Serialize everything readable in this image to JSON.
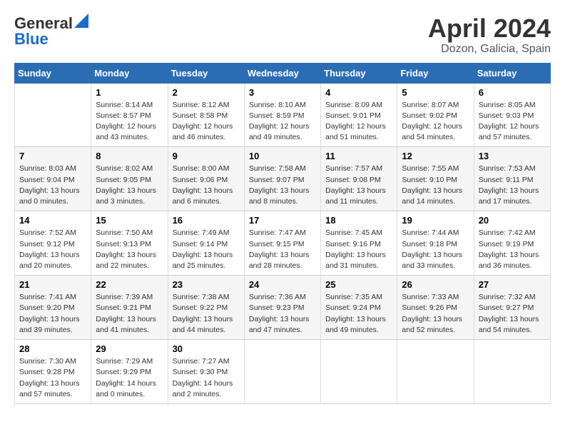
{
  "header": {
    "logo_general": "General",
    "logo_blue": "Blue",
    "month_title": "April 2024",
    "location": "Dozon, Galicia, Spain"
  },
  "columns": [
    "Sunday",
    "Monday",
    "Tuesday",
    "Wednesday",
    "Thursday",
    "Friday",
    "Saturday"
  ],
  "weeks": [
    [
      {
        "day": "",
        "sunrise": "",
        "sunset": "",
        "daylight": ""
      },
      {
        "day": "1",
        "sunrise": "Sunrise: 8:14 AM",
        "sunset": "Sunset: 8:57 PM",
        "daylight": "Daylight: 12 hours and 43 minutes."
      },
      {
        "day": "2",
        "sunrise": "Sunrise: 8:12 AM",
        "sunset": "Sunset: 8:58 PM",
        "daylight": "Daylight: 12 hours and 46 minutes."
      },
      {
        "day": "3",
        "sunrise": "Sunrise: 8:10 AM",
        "sunset": "Sunset: 8:59 PM",
        "daylight": "Daylight: 12 hours and 49 minutes."
      },
      {
        "day": "4",
        "sunrise": "Sunrise: 8:09 AM",
        "sunset": "Sunset: 9:01 PM",
        "daylight": "Daylight: 12 hours and 51 minutes."
      },
      {
        "day": "5",
        "sunrise": "Sunrise: 8:07 AM",
        "sunset": "Sunset: 9:02 PM",
        "daylight": "Daylight: 12 hours and 54 minutes."
      },
      {
        "day": "6",
        "sunrise": "Sunrise: 8:05 AM",
        "sunset": "Sunset: 9:03 PM",
        "daylight": "Daylight: 12 hours and 57 minutes."
      }
    ],
    [
      {
        "day": "7",
        "sunrise": "Sunrise: 8:03 AM",
        "sunset": "Sunset: 9:04 PM",
        "daylight": "Daylight: 13 hours and 0 minutes."
      },
      {
        "day": "8",
        "sunrise": "Sunrise: 8:02 AM",
        "sunset": "Sunset: 9:05 PM",
        "daylight": "Daylight: 13 hours and 3 minutes."
      },
      {
        "day": "9",
        "sunrise": "Sunrise: 8:00 AM",
        "sunset": "Sunset: 9:06 PM",
        "daylight": "Daylight: 13 hours and 6 minutes."
      },
      {
        "day": "10",
        "sunrise": "Sunrise: 7:58 AM",
        "sunset": "Sunset: 9:07 PM",
        "daylight": "Daylight: 13 hours and 8 minutes."
      },
      {
        "day": "11",
        "sunrise": "Sunrise: 7:57 AM",
        "sunset": "Sunset: 9:08 PM",
        "daylight": "Daylight: 13 hours and 11 minutes."
      },
      {
        "day": "12",
        "sunrise": "Sunrise: 7:55 AM",
        "sunset": "Sunset: 9:10 PM",
        "daylight": "Daylight: 13 hours and 14 minutes."
      },
      {
        "day": "13",
        "sunrise": "Sunrise: 7:53 AM",
        "sunset": "Sunset: 9:11 PM",
        "daylight": "Daylight: 13 hours and 17 minutes."
      }
    ],
    [
      {
        "day": "14",
        "sunrise": "Sunrise: 7:52 AM",
        "sunset": "Sunset: 9:12 PM",
        "daylight": "Daylight: 13 hours and 20 minutes."
      },
      {
        "day": "15",
        "sunrise": "Sunrise: 7:50 AM",
        "sunset": "Sunset: 9:13 PM",
        "daylight": "Daylight: 13 hours and 22 minutes."
      },
      {
        "day": "16",
        "sunrise": "Sunrise: 7:49 AM",
        "sunset": "Sunset: 9:14 PM",
        "daylight": "Daylight: 13 hours and 25 minutes."
      },
      {
        "day": "17",
        "sunrise": "Sunrise: 7:47 AM",
        "sunset": "Sunset: 9:15 PM",
        "daylight": "Daylight: 13 hours and 28 minutes."
      },
      {
        "day": "18",
        "sunrise": "Sunrise: 7:45 AM",
        "sunset": "Sunset: 9:16 PM",
        "daylight": "Daylight: 13 hours and 31 minutes."
      },
      {
        "day": "19",
        "sunrise": "Sunrise: 7:44 AM",
        "sunset": "Sunset: 9:18 PM",
        "daylight": "Daylight: 13 hours and 33 minutes."
      },
      {
        "day": "20",
        "sunrise": "Sunrise: 7:42 AM",
        "sunset": "Sunset: 9:19 PM",
        "daylight": "Daylight: 13 hours and 36 minutes."
      }
    ],
    [
      {
        "day": "21",
        "sunrise": "Sunrise: 7:41 AM",
        "sunset": "Sunset: 9:20 PM",
        "daylight": "Daylight: 13 hours and 39 minutes."
      },
      {
        "day": "22",
        "sunrise": "Sunrise: 7:39 AM",
        "sunset": "Sunset: 9:21 PM",
        "daylight": "Daylight: 13 hours and 41 minutes."
      },
      {
        "day": "23",
        "sunrise": "Sunrise: 7:38 AM",
        "sunset": "Sunset: 9:22 PM",
        "daylight": "Daylight: 13 hours and 44 minutes."
      },
      {
        "day": "24",
        "sunrise": "Sunrise: 7:36 AM",
        "sunset": "Sunset: 9:23 PM",
        "daylight": "Daylight: 13 hours and 47 minutes."
      },
      {
        "day": "25",
        "sunrise": "Sunrise: 7:35 AM",
        "sunset": "Sunset: 9:24 PM",
        "daylight": "Daylight: 13 hours and 49 minutes."
      },
      {
        "day": "26",
        "sunrise": "Sunrise: 7:33 AM",
        "sunset": "Sunset: 9:26 PM",
        "daylight": "Daylight: 13 hours and 52 minutes."
      },
      {
        "day": "27",
        "sunrise": "Sunrise: 7:32 AM",
        "sunset": "Sunset: 9:27 PM",
        "daylight": "Daylight: 13 hours and 54 minutes."
      }
    ],
    [
      {
        "day": "28",
        "sunrise": "Sunrise: 7:30 AM",
        "sunset": "Sunset: 9:28 PM",
        "daylight": "Daylight: 13 hours and 57 minutes."
      },
      {
        "day": "29",
        "sunrise": "Sunrise: 7:29 AM",
        "sunset": "Sunset: 9:29 PM",
        "daylight": "Daylight: 14 hours and 0 minutes."
      },
      {
        "day": "30",
        "sunrise": "Sunrise: 7:27 AM",
        "sunset": "Sunset: 9:30 PM",
        "daylight": "Daylight: 14 hours and 2 minutes."
      },
      {
        "day": "",
        "sunrise": "",
        "sunset": "",
        "daylight": ""
      },
      {
        "day": "",
        "sunrise": "",
        "sunset": "",
        "daylight": ""
      },
      {
        "day": "",
        "sunrise": "",
        "sunset": "",
        "daylight": ""
      },
      {
        "day": "",
        "sunrise": "",
        "sunset": "",
        "daylight": ""
      }
    ]
  ]
}
